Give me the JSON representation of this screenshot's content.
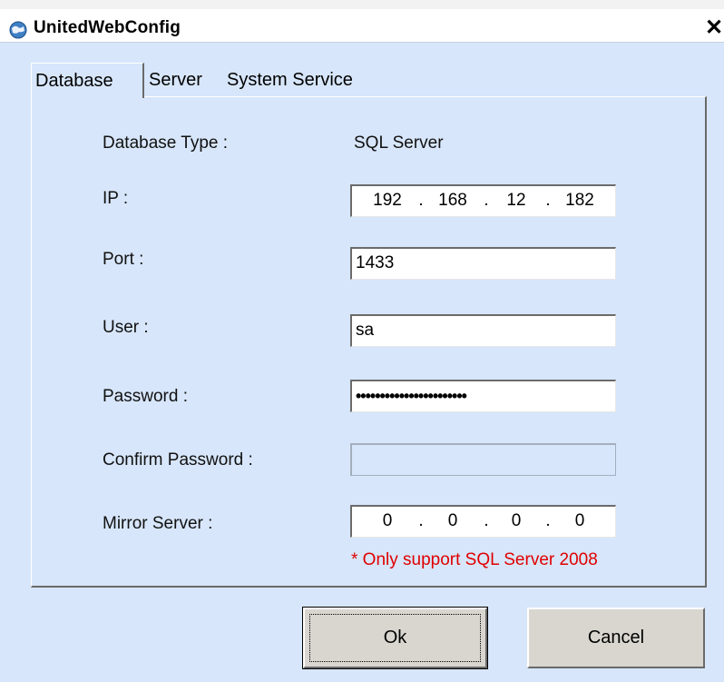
{
  "window": {
    "title": "UnitedWebConfig",
    "close_glyph": "✕"
  },
  "tabs": [
    {
      "label": "Database",
      "active": true
    },
    {
      "label": "Server",
      "active": false
    },
    {
      "label": "System Service",
      "active": false
    }
  ],
  "form": {
    "database_type": {
      "label": "Database Type :",
      "value": "SQL Server"
    },
    "ip": {
      "label": "IP :",
      "octets": [
        "192",
        "168",
        "12",
        "182"
      ]
    },
    "port": {
      "label": "Port :",
      "value": "1433"
    },
    "user": {
      "label": "User :",
      "value": "sa"
    },
    "password": {
      "label": "Password :",
      "value": "•••••••••••••••••••••••"
    },
    "confirm_password": {
      "label": "Confirm Password :",
      "value": ""
    },
    "mirror_server": {
      "label": "Mirror Server :",
      "octets": [
        "0",
        "0",
        "0",
        "0"
      ]
    },
    "note": "* Only support SQL Server 2008"
  },
  "buttons": {
    "ok": "Ok",
    "cancel": "Cancel"
  },
  "icons": {
    "app": "globe-icon",
    "close": "close-icon"
  },
  "colors": {
    "background": "#d7e6fa",
    "note": "#e00000",
    "button": "#d8d6cf"
  }
}
